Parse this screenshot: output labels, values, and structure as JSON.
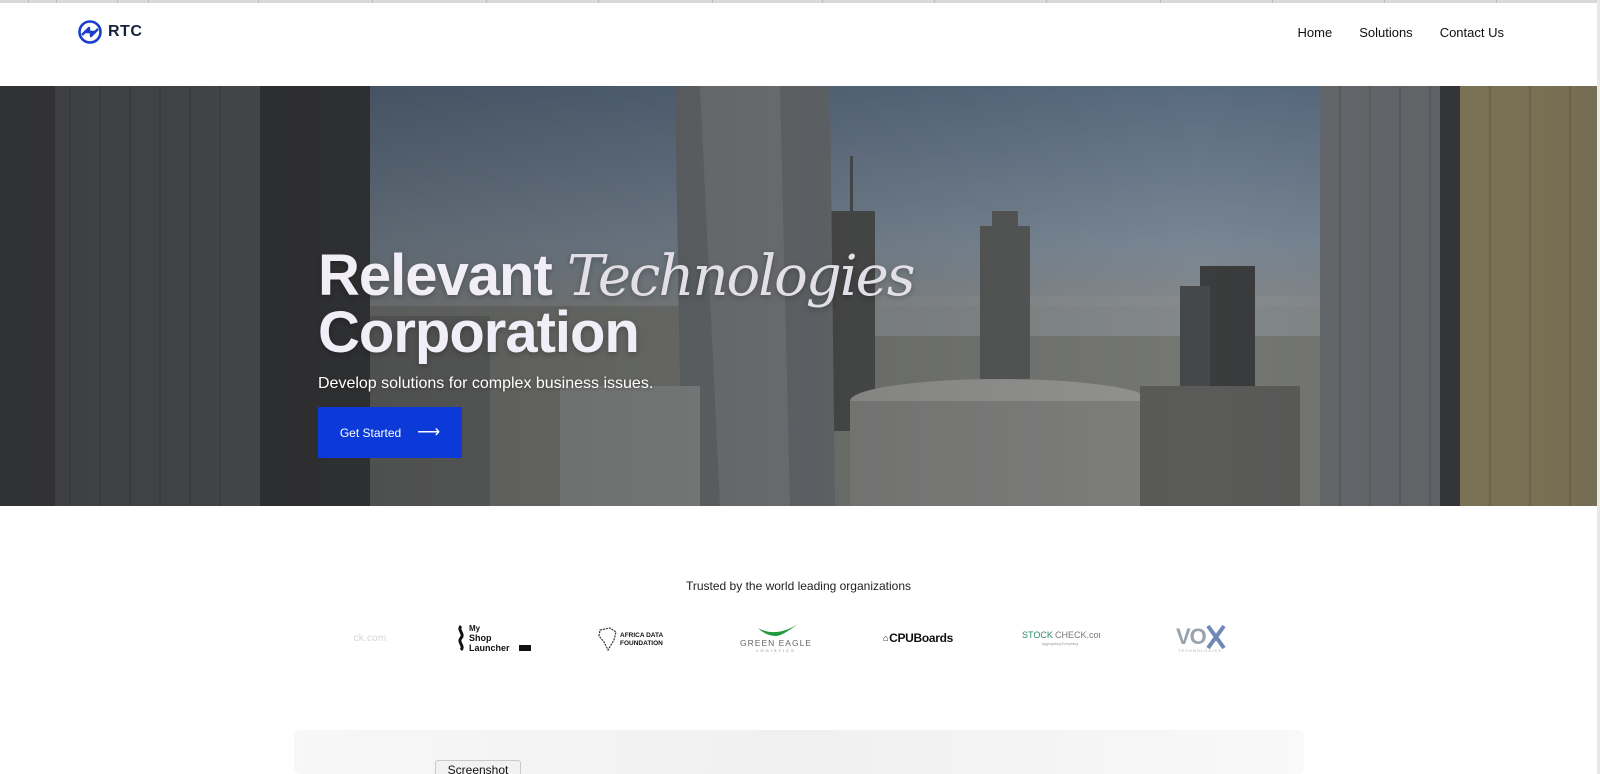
{
  "brand": {
    "name": "RTC",
    "logo_icon": "rtc-logo-icon",
    "accent": "#0b3ad8",
    "dark": "#16233d"
  },
  "nav": {
    "items": [
      {
        "label": "Home"
      },
      {
        "label": "Solutions"
      },
      {
        "label": "Contact Us"
      }
    ]
  },
  "hero": {
    "title_bold_1": "Relevant",
    "title_italic": "Technologies",
    "title_bold_2": "Corporation",
    "subtitle": "Develop solutions for complex business issues.",
    "cta_label": "Get Started",
    "cta_icon": "arrow-right-icon",
    "background": "city-skyline-photo"
  },
  "trusted": {
    "heading": "Trusted by the world leading organizations",
    "logos": [
      {
        "name": "stockcheck-logo-faded",
        "text": "ck.com"
      },
      {
        "name": "myshop-launcher-logo",
        "text": "My Shop Launcher"
      },
      {
        "name": "africa-data-foundation-logo",
        "text": "AFRICA DATA FOUNDATION"
      },
      {
        "name": "green-eagle-logo",
        "text": "GREEN EAGLE"
      },
      {
        "name": "cpuboards-logo",
        "text": "CPUBoards"
      },
      {
        "name": "stockcheck-logo",
        "text": "STOCKCHECK.com"
      },
      {
        "name": "vox-technologies-logo",
        "text": "VOX"
      }
    ]
  },
  "screenshot_tab": {
    "label": "Screenshot"
  }
}
